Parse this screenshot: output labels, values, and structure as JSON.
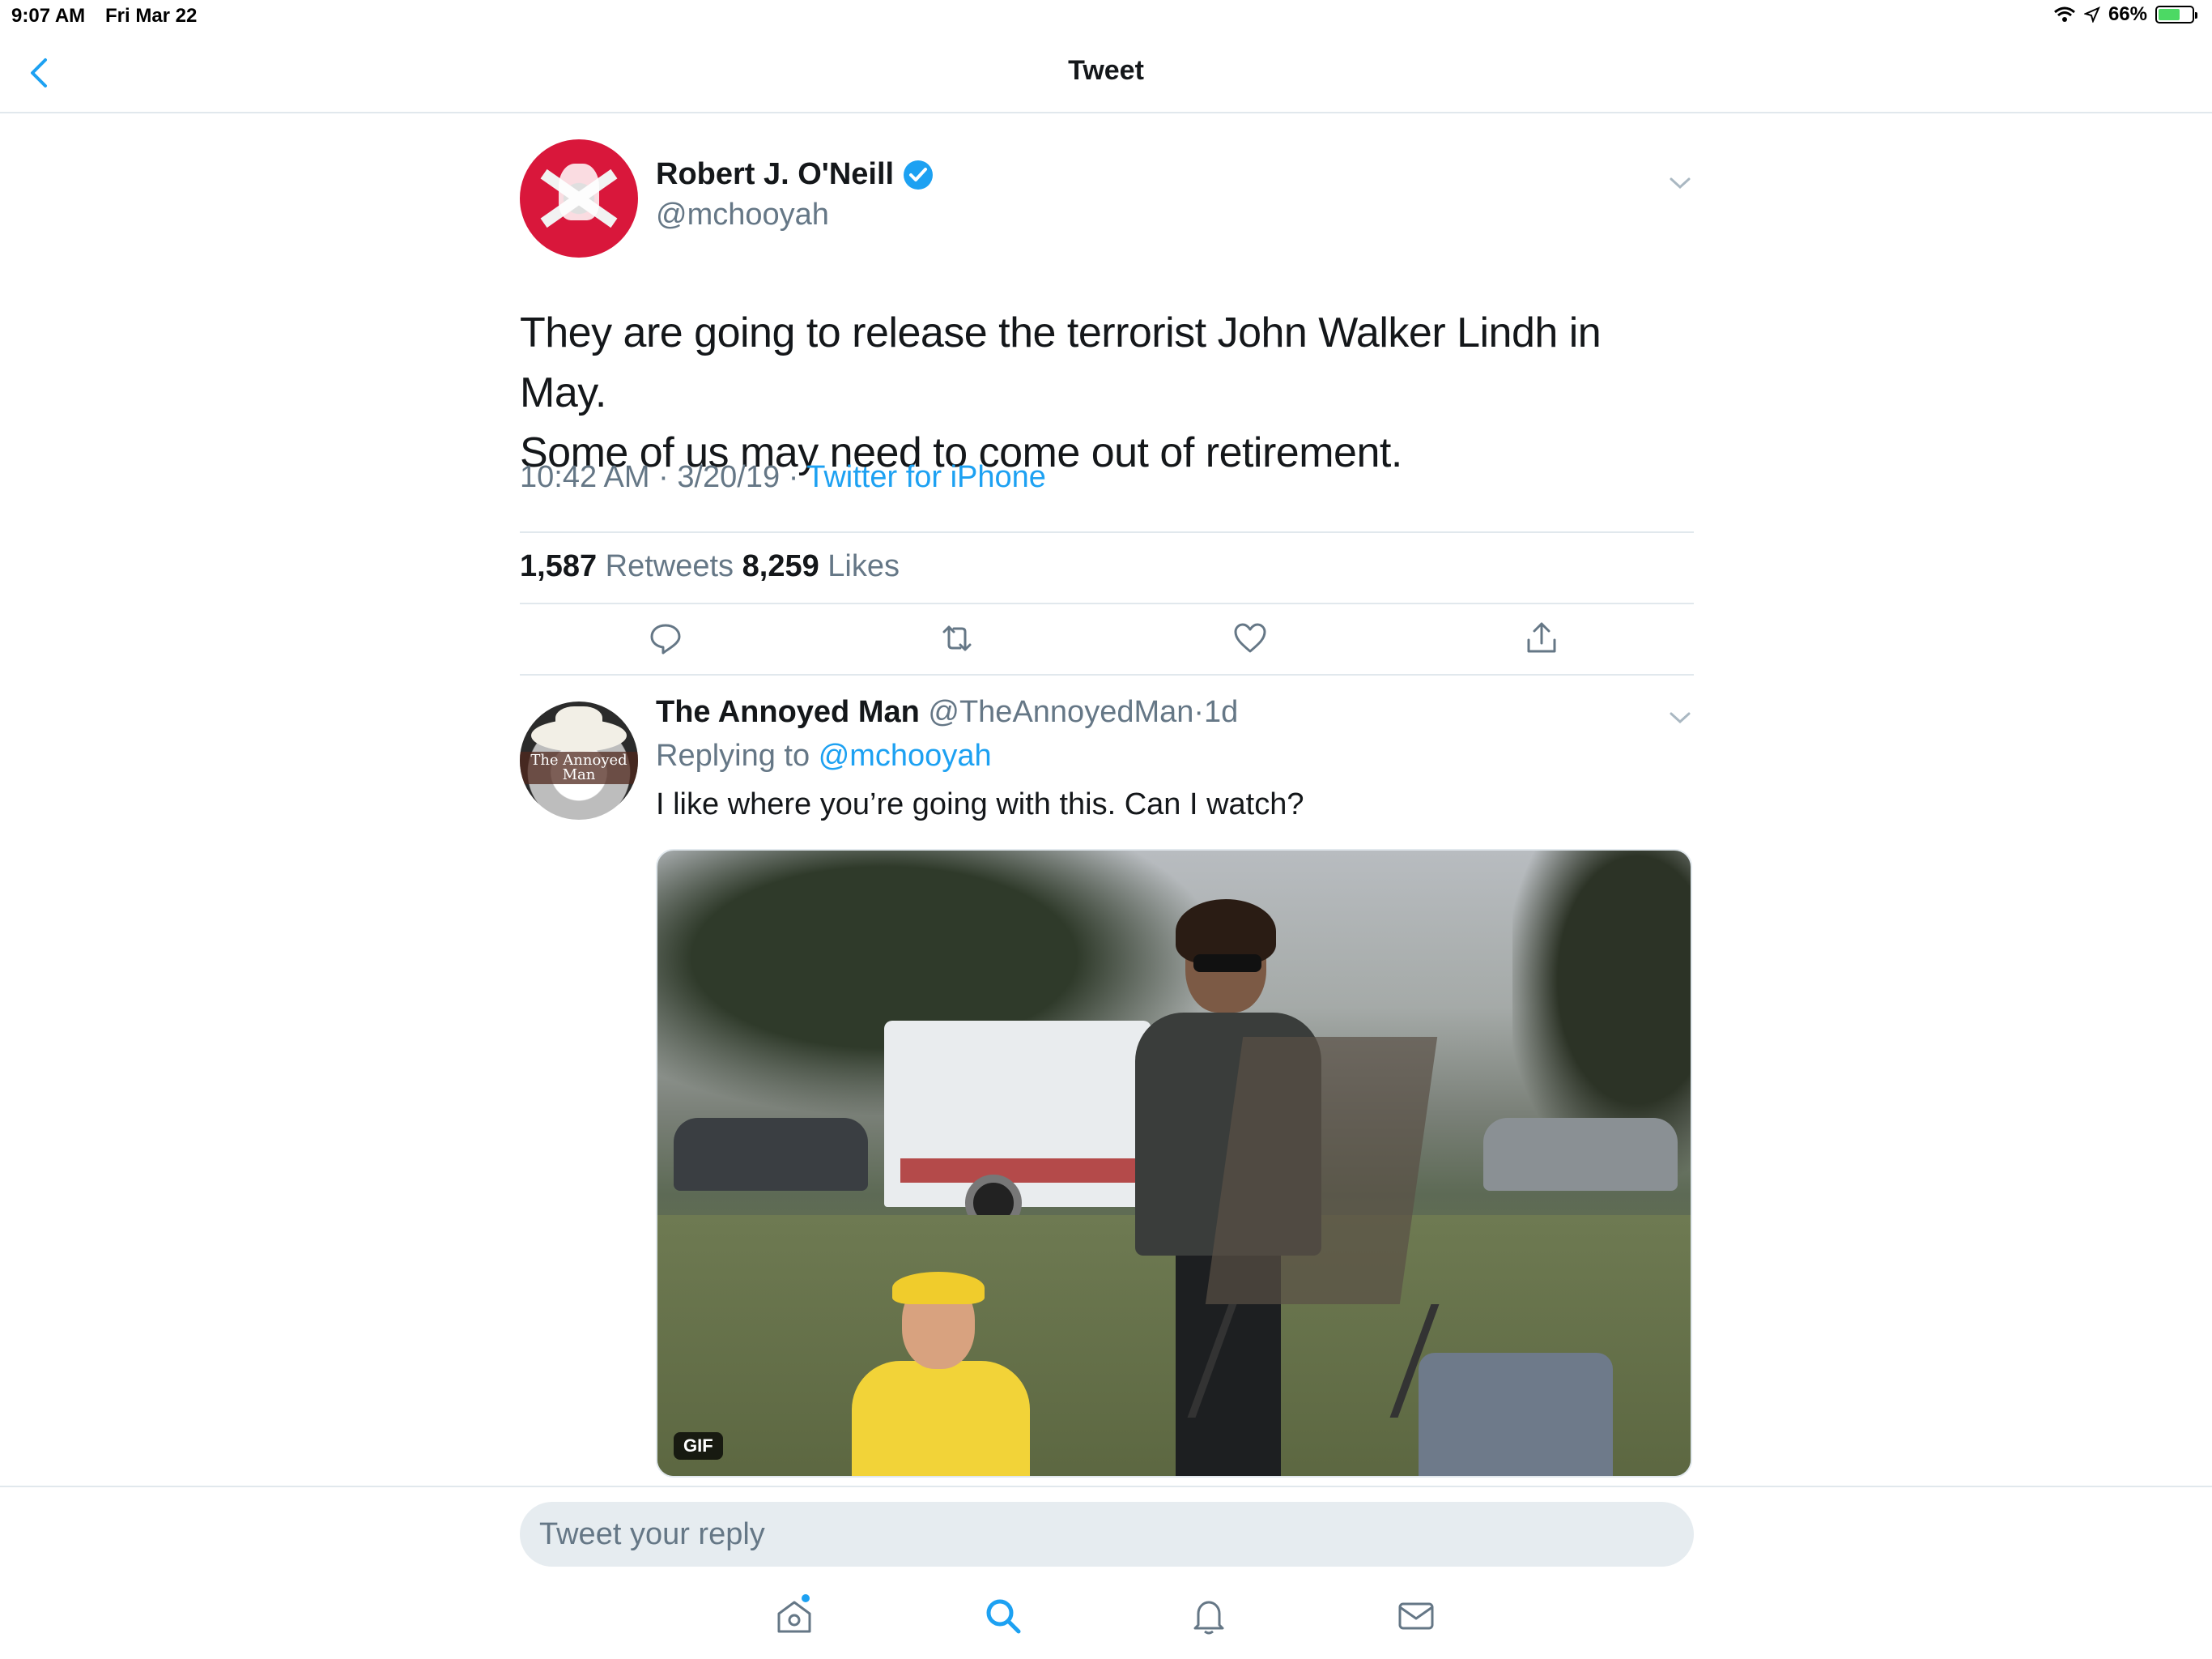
{
  "status_bar": {
    "time": "9:07 AM",
    "date": "Fri Mar 22",
    "battery": "66%",
    "battery_level": 0.66
  },
  "nav": {
    "title": "Tweet",
    "back_icon": "chevron-left-icon"
  },
  "tweet": {
    "author_name": "Robert J. O'Neill",
    "author_handle": "@mchooyah",
    "verified": true,
    "text_line1": "They are going to release the terrorist John Walker Lindh in May.",
    "text_line2": "Some of us may need to come out of retirement.",
    "time": "10:42 AM",
    "date": "3/20/19",
    "sep": "·",
    "source": "Twitter for iPhone",
    "retweets_count": "1,587",
    "retweets_label": "Retweets",
    "likes_count": "8,259",
    "likes_label": "Likes"
  },
  "actions": [
    "reply-icon",
    "retweet-icon",
    "heart-icon",
    "share-icon"
  ],
  "reply": {
    "author_name": "The Annoyed Man",
    "author_handle": "@TheAnnoyedMan",
    "age": "1d",
    "replying_prefix": "Replying to",
    "replying_handle": "@mchooyah",
    "text": "I like where you’re going with this. Can I watch?",
    "gif_badge": "GIF",
    "avatar_text": "The Annoyed Man"
  },
  "composer": {
    "placeholder": "Tweet your reply"
  },
  "tab_bar": [
    "home-icon",
    "search-icon",
    "notifications-icon",
    "messages-icon"
  ],
  "colors": {
    "accent": "#1da1f2",
    "text_primary": "#14171a",
    "text_secondary": "#657786",
    "divider": "#e1e8ed"
  }
}
